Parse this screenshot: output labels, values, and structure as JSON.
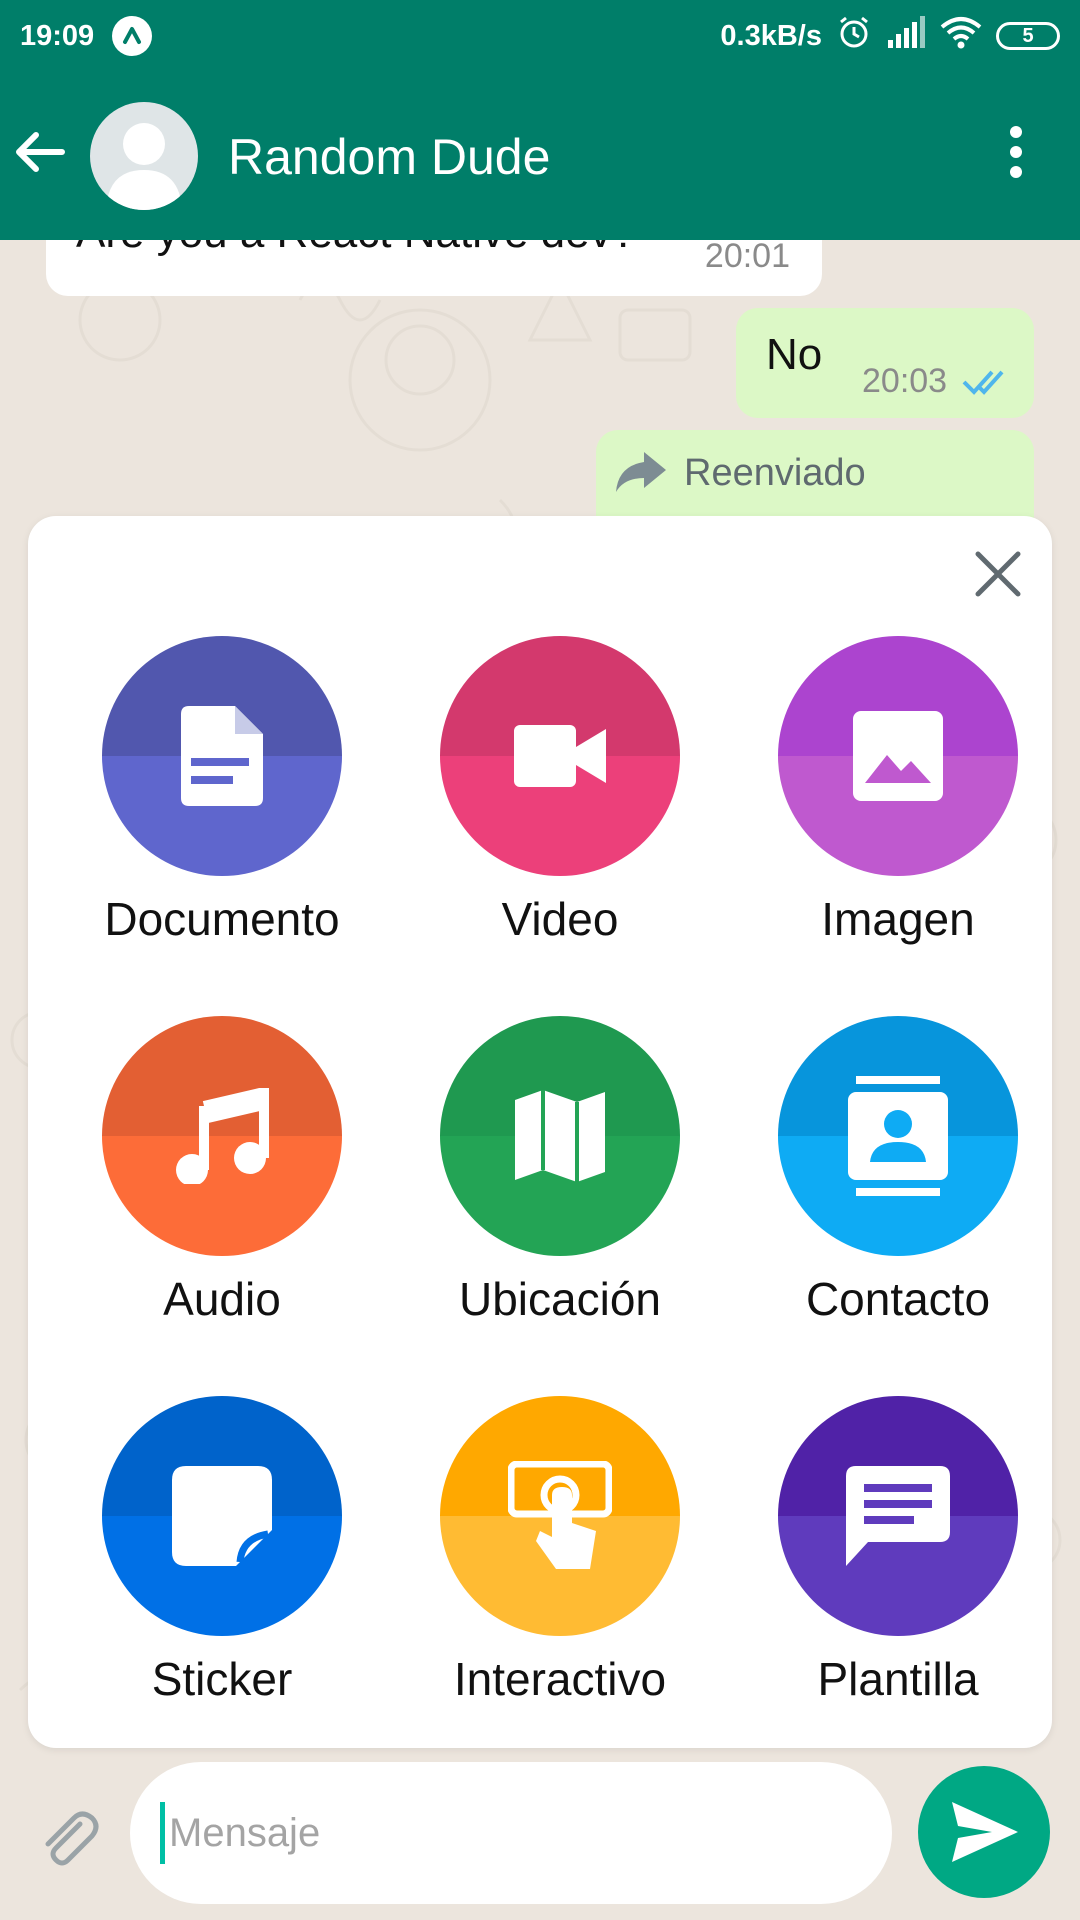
{
  "status_bar": {
    "time": "19:09",
    "app_indicator_icon": "arrow-up-icon",
    "network_speed": "0.3kB/s",
    "battery_level": "5",
    "icons": [
      "alarm-icon",
      "signal-icon",
      "wifi-icon",
      "battery-icon"
    ]
  },
  "header": {
    "back_icon": "back-arrow-icon",
    "contact_name": "Random Dude",
    "menu_icon": "more-vert-icon",
    "background_color": "#007e69"
  },
  "messages": [
    {
      "direction": "incoming",
      "text": "Are you a React Native dev?",
      "time": "20:01"
    },
    {
      "direction": "outgoing",
      "text": "No",
      "time": "20:03",
      "status": "read"
    },
    {
      "direction": "outgoing",
      "forwarded_label": "Reenviado"
    }
  ],
  "attachment_sheet": {
    "close_icon": "close-icon",
    "items": [
      {
        "label": "Documento",
        "icon": "document-icon",
        "color_top": "#5157ae",
        "color_bottom": "#5f66cd"
      },
      {
        "label": "Video",
        "icon": "video-camera-icon",
        "color_top": "#d3396d",
        "color_bottom": "#ec407a"
      },
      {
        "label": "Imagen",
        "icon": "image-icon",
        "color_top": "#ac44cf",
        "color_bottom": "#bf59cf"
      },
      {
        "label": "Audio",
        "icon": "music-note-icon",
        "color_top": "#e35f33",
        "color_bottom": "#fd6c38"
      },
      {
        "label": "Ubicación",
        "icon": "map-icon",
        "color_top": "#1f9950",
        "color_bottom": "#23a455"
      },
      {
        "label": "Contacto",
        "icon": "contact-card-icon",
        "color_top": "#0795dc",
        "color_bottom": "#0eabf4"
      },
      {
        "label": "Sticker",
        "icon": "sticker-icon",
        "color_top": "#0063cb",
        "color_bottom": "#0070e6"
      },
      {
        "label": "Interactivo",
        "icon": "touch-icon",
        "color_top": "#ffa800",
        "color_bottom": "#ffbb33"
      },
      {
        "label": "Plantilla",
        "icon": "chat-template-icon",
        "color_top": "#5022a7",
        "color_bottom": "#5f3bbd"
      }
    ]
  },
  "composer": {
    "attach_icon": "paperclip-icon",
    "placeholder": "Mensaje",
    "value": "",
    "send_icon": "send-icon",
    "send_color": "#00a884"
  }
}
